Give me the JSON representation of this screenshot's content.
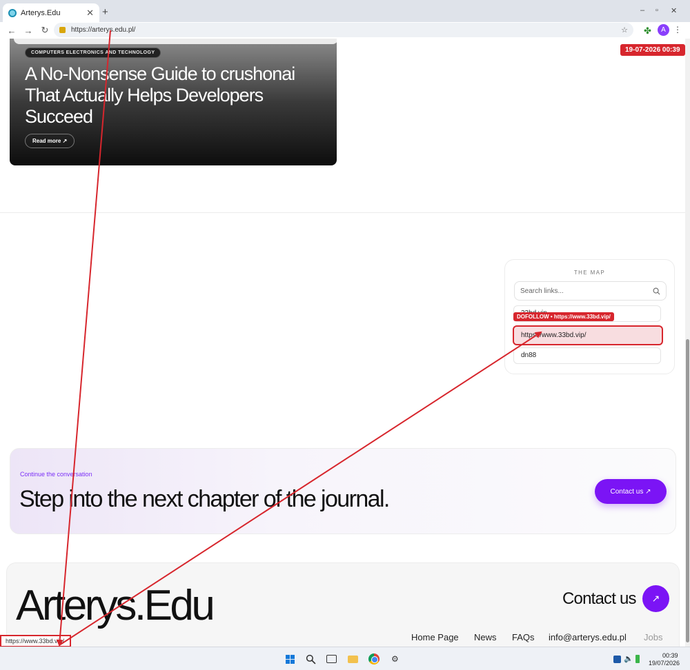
{
  "browser": {
    "tab_title": "Arterys.Edu",
    "tab_close": "✕",
    "new_tab": "+",
    "url": "https://arterys.edu.pl/",
    "back": "←",
    "forward": "→",
    "reload": "↻",
    "bookmark": "☆",
    "profile_initial": "A",
    "menu": "⋮",
    "minimize": "–",
    "maximize": "▫",
    "close": "✕"
  },
  "timestamp_badge": "19-07-2026 00:39",
  "hero": {
    "category": "COMPUTERS ELECTRONICS AND TECHNOLOGY",
    "title": "A No-Nonsense Guide to crushonai That Actually Helps Developers Succeed",
    "read_more": "Read more ↗"
  },
  "map": {
    "title": "THE MAP",
    "search_placeholder": "Search links...",
    "items": [
      "33bd.vip",
      "https://www.33bd.vip/",
      "dn88"
    ],
    "dofollow_tag": "DOFOLLOW • https://www.33bd.vip/"
  },
  "cta": {
    "eyebrow": "Continue the conversation",
    "heading": "Step into the next chapter of the journal.",
    "button": "Contact us ↗"
  },
  "footer": {
    "logo": "Arterys.Edu",
    "contact": "Contact us",
    "arrow": "↗",
    "links": [
      "Home Page",
      "News",
      "FAQs",
      "info@arterys.edu.pl",
      "Jobs"
    ]
  },
  "status_bar_url": "https://www.33bd.vip/",
  "taskbar": {
    "time": "00:39",
    "date": "19/07/2026"
  },
  "colors": {
    "accent": "#7b14f5",
    "annotation_red": "#d7262d"
  }
}
